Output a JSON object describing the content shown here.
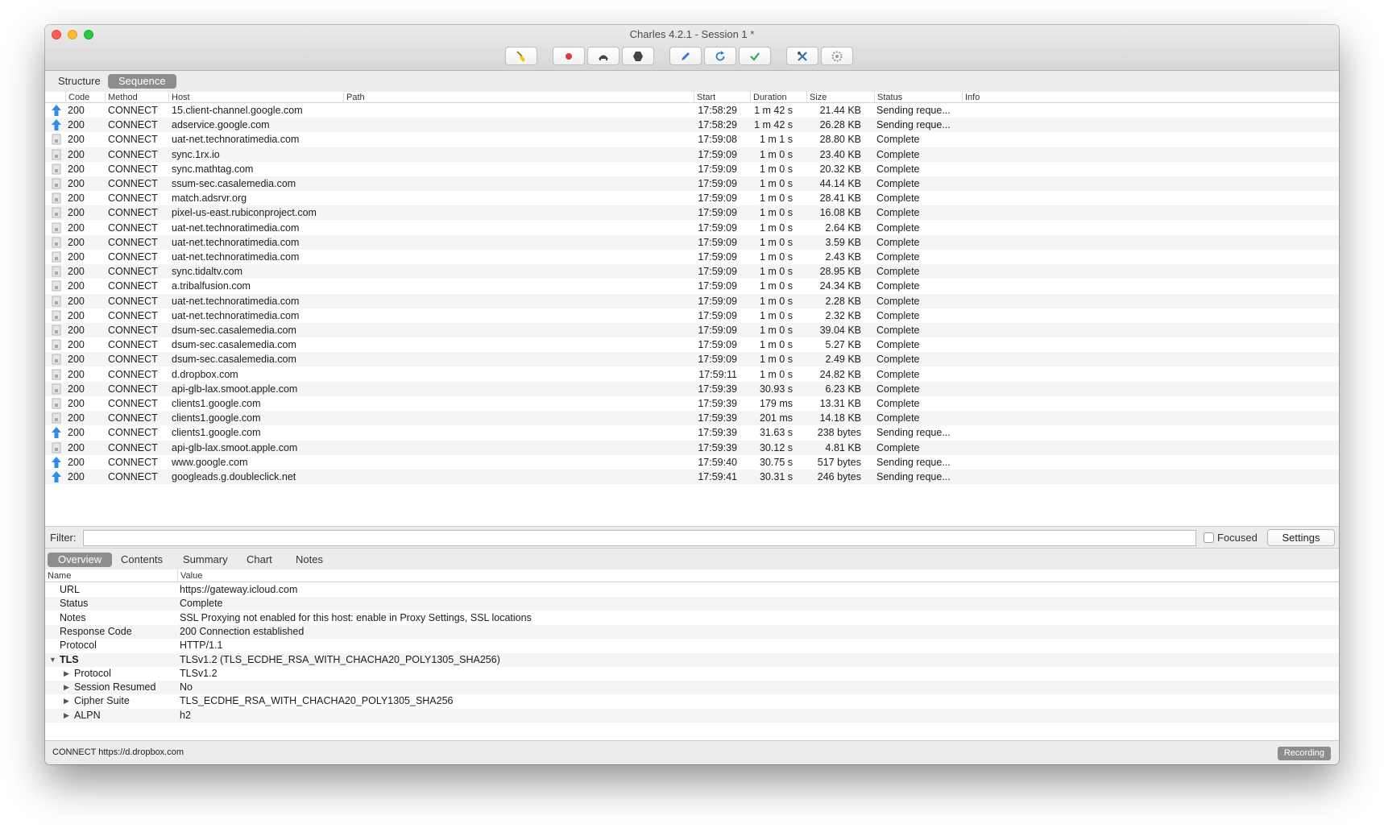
{
  "window": {
    "title": "Charles 4.2.1 - Session 1 *"
  },
  "toolbar": {
    "buttons": [
      {
        "name": "broom-icon",
        "color": "#e6b800"
      },
      {
        "name": "record-icon",
        "color": "#e23b3b"
      },
      {
        "name": "throttle-turtle-icon",
        "color": "#333333"
      },
      {
        "name": "breakpoints-hexagon-icon",
        "color": "#333333"
      },
      {
        "name": "compose-pen-icon",
        "color": "#2a7fd6"
      },
      {
        "name": "repeat-refresh-icon",
        "color": "#2a7fd6"
      },
      {
        "name": "validate-check-icon",
        "color": "#2fa84f"
      },
      {
        "name": "tools-icon",
        "color": "#2a6fb5"
      },
      {
        "name": "settings-gear-icon",
        "color": "#9a9a9a"
      }
    ]
  },
  "view_tabs": [
    {
      "label": "Structure",
      "active": false
    },
    {
      "label": "Sequence",
      "active": true
    }
  ],
  "table": {
    "headers": {
      "code": "Code",
      "method": "Method",
      "host": "Host",
      "path": "Path",
      "start": "Start",
      "duration": "Duration",
      "size": "Size",
      "status": "Status",
      "info": "Info"
    },
    "rows": [
      {
        "icon": "upload-arrow-icon",
        "code": "200",
        "method": "CONNECT",
        "host": "15.client-channel.google.com",
        "path": "",
        "start": "17:58:29",
        "duration": "1 m 42 s",
        "size": "21.44 KB",
        "status": "Sending reque...",
        "info": ""
      },
      {
        "icon": "upload-arrow-icon",
        "code": "200",
        "method": "CONNECT",
        "host": "adservice.google.com",
        "path": "",
        "start": "17:58:29",
        "duration": "1 m 42 s",
        "size": "26.28 KB",
        "status": "Sending reque...",
        "info": ""
      },
      {
        "icon": "lock-icon",
        "code": "200",
        "method": "CONNECT",
        "host": "uat-net.technoratimedia.com",
        "path": "",
        "start": "17:59:08",
        "duration": "1 m 1 s",
        "size": "28.80 KB",
        "status": "Complete",
        "info": ""
      },
      {
        "icon": "lock-icon",
        "code": "200",
        "method": "CONNECT",
        "host": "sync.1rx.io",
        "path": "",
        "start": "17:59:09",
        "duration": "1 m 0 s",
        "size": "23.40 KB",
        "status": "Complete",
        "info": ""
      },
      {
        "icon": "lock-icon",
        "code": "200",
        "method": "CONNECT",
        "host": "sync.mathtag.com",
        "path": "",
        "start": "17:59:09",
        "duration": "1 m 0 s",
        "size": "20.32 KB",
        "status": "Complete",
        "info": ""
      },
      {
        "icon": "lock-icon",
        "code": "200",
        "method": "CONNECT",
        "host": "ssum-sec.casalemedia.com",
        "path": "",
        "start": "17:59:09",
        "duration": "1 m 0 s",
        "size": "44.14 KB",
        "status": "Complete",
        "info": ""
      },
      {
        "icon": "lock-icon",
        "code": "200",
        "method": "CONNECT",
        "host": "match.adsrvr.org",
        "path": "",
        "start": "17:59:09",
        "duration": "1 m 0 s",
        "size": "28.41 KB",
        "status": "Complete",
        "info": ""
      },
      {
        "icon": "lock-icon",
        "code": "200",
        "method": "CONNECT",
        "host": "pixel-us-east.rubiconproject.com",
        "path": "",
        "start": "17:59:09",
        "duration": "1 m 0 s",
        "size": "16.08 KB",
        "status": "Complete",
        "info": ""
      },
      {
        "icon": "lock-icon",
        "code": "200",
        "method": "CONNECT",
        "host": "uat-net.technoratimedia.com",
        "path": "",
        "start": "17:59:09",
        "duration": "1 m 0 s",
        "size": "2.64 KB",
        "status": "Complete",
        "info": ""
      },
      {
        "icon": "lock-icon",
        "code": "200",
        "method": "CONNECT",
        "host": "uat-net.technoratimedia.com",
        "path": "",
        "start": "17:59:09",
        "duration": "1 m 0 s",
        "size": "3.59 KB",
        "status": "Complete",
        "info": ""
      },
      {
        "icon": "lock-icon",
        "code": "200",
        "method": "CONNECT",
        "host": "uat-net.technoratimedia.com",
        "path": "",
        "start": "17:59:09",
        "duration": "1 m 0 s",
        "size": "2.43 KB",
        "status": "Complete",
        "info": ""
      },
      {
        "icon": "lock-icon",
        "code": "200",
        "method": "CONNECT",
        "host": "sync.tidaltv.com",
        "path": "",
        "start": "17:59:09",
        "duration": "1 m 0 s",
        "size": "28.95 KB",
        "status": "Complete",
        "info": ""
      },
      {
        "icon": "lock-icon",
        "code": "200",
        "method": "CONNECT",
        "host": "a.tribalfusion.com",
        "path": "",
        "start": "17:59:09",
        "duration": "1 m 0 s",
        "size": "24.34 KB",
        "status": "Complete",
        "info": ""
      },
      {
        "icon": "lock-icon",
        "code": "200",
        "method": "CONNECT",
        "host": "uat-net.technoratimedia.com",
        "path": "",
        "start": "17:59:09",
        "duration": "1 m 0 s",
        "size": "2.28 KB",
        "status": "Complete",
        "info": ""
      },
      {
        "icon": "lock-icon",
        "code": "200",
        "method": "CONNECT",
        "host": "uat-net.technoratimedia.com",
        "path": "",
        "start": "17:59:09",
        "duration": "1 m 0 s",
        "size": "2.32 KB",
        "status": "Complete",
        "info": ""
      },
      {
        "icon": "lock-icon",
        "code": "200",
        "method": "CONNECT",
        "host": "dsum-sec.casalemedia.com",
        "path": "",
        "start": "17:59:09",
        "duration": "1 m 0 s",
        "size": "39.04 KB",
        "status": "Complete",
        "info": ""
      },
      {
        "icon": "lock-icon",
        "code": "200",
        "method": "CONNECT",
        "host": "dsum-sec.casalemedia.com",
        "path": "",
        "start": "17:59:09",
        "duration": "1 m 0 s",
        "size": "5.27 KB",
        "status": "Complete",
        "info": ""
      },
      {
        "icon": "lock-icon",
        "code": "200",
        "method": "CONNECT",
        "host": "dsum-sec.casalemedia.com",
        "path": "",
        "start": "17:59:09",
        "duration": "1 m 0 s",
        "size": "2.49 KB",
        "status": "Complete",
        "info": ""
      },
      {
        "icon": "lock-icon",
        "code": "200",
        "method": "CONNECT",
        "host": "d.dropbox.com",
        "path": "",
        "start": "17:59:11",
        "duration": "1 m 0 s",
        "size": "24.82 KB",
        "status": "Complete",
        "info": ""
      },
      {
        "icon": "lock-icon",
        "code": "200",
        "method": "CONNECT",
        "host": "api-glb-lax.smoot.apple.com",
        "path": "",
        "start": "17:59:39",
        "duration": "30.93 s",
        "size": "6.23 KB",
        "status": "Complete",
        "info": ""
      },
      {
        "icon": "lock-icon",
        "code": "200",
        "method": "CONNECT",
        "host": "clients1.google.com",
        "path": "",
        "start": "17:59:39",
        "duration": "179 ms",
        "size": "13.31 KB",
        "status": "Complete",
        "info": ""
      },
      {
        "icon": "lock-icon",
        "code": "200",
        "method": "CONNECT",
        "host": "clients1.google.com",
        "path": "",
        "start": "17:59:39",
        "duration": "201 ms",
        "size": "14.18 KB",
        "status": "Complete",
        "info": ""
      },
      {
        "icon": "upload-arrow-icon",
        "code": "200",
        "method": "CONNECT",
        "host": "clients1.google.com",
        "path": "",
        "start": "17:59:39",
        "duration": "31.63 s",
        "size": "238 bytes",
        "status": "Sending reque...",
        "info": ""
      },
      {
        "icon": "lock-icon",
        "code": "200",
        "method": "CONNECT",
        "host": "api-glb-lax.smoot.apple.com",
        "path": "",
        "start": "17:59:39",
        "duration": "30.12 s",
        "size": "4.81 KB",
        "status": "Complete",
        "info": ""
      },
      {
        "icon": "upload-arrow-icon",
        "code": "200",
        "method": "CONNECT",
        "host": "www.google.com",
        "path": "",
        "start": "17:59:40",
        "duration": "30.75 s",
        "size": "517 bytes",
        "status": "Sending reque...",
        "info": ""
      },
      {
        "icon": "upload-arrow-icon",
        "code": "200",
        "method": "CONNECT",
        "host": "googleads.g.doubleclick.net",
        "path": "",
        "start": "17:59:41",
        "duration": "30.31 s",
        "size": "246 bytes",
        "status": "Sending reque...",
        "info": ""
      }
    ]
  },
  "filter": {
    "label": "Filter:",
    "value": "",
    "focused_label": "Focused",
    "focused_checked": false,
    "settings_label": "Settings"
  },
  "detail_tabs": [
    {
      "label": "Overview",
      "active": true
    },
    {
      "label": "Contents",
      "active": false
    },
    {
      "label": "Summary",
      "active": false
    },
    {
      "label": "Chart",
      "active": false
    },
    {
      "label": "Notes",
      "active": false
    }
  ],
  "overview": {
    "headers": {
      "name": "Name",
      "value": "Value"
    },
    "rows": [
      {
        "name": "URL",
        "value": "https://gateway.icloud.com",
        "level": 0,
        "expander": ""
      },
      {
        "name": "Status",
        "value": "Complete",
        "level": 0,
        "expander": ""
      },
      {
        "name": "Notes",
        "value": "SSL Proxying not enabled for this host: enable in Proxy Settings, SSL locations",
        "level": 0,
        "expander": ""
      },
      {
        "name": "Response Code",
        "value": "200 Connection established",
        "level": 0,
        "expander": ""
      },
      {
        "name": "Protocol",
        "value": "HTTP/1.1",
        "level": 0,
        "expander": ""
      },
      {
        "name": "TLS",
        "value": "TLSv1.2 (TLS_ECDHE_RSA_WITH_CHACHA20_POLY1305_SHA256)",
        "level": 0,
        "expander": "expanded",
        "bold": true
      },
      {
        "name": "Protocol",
        "value": "TLSv1.2",
        "level": 1,
        "expander": "collapsed"
      },
      {
        "name": "Session Resumed",
        "value": "No",
        "level": 1,
        "expander": "collapsed"
      },
      {
        "name": "Cipher Suite",
        "value": "TLS_ECDHE_RSA_WITH_CHACHA20_POLY1305_SHA256",
        "level": 1,
        "expander": "collapsed"
      },
      {
        "name": "ALPN",
        "value": "h2",
        "level": 1,
        "expander": "collapsed"
      }
    ]
  },
  "status_bar": {
    "text": "CONNECT https://d.dropbox.com",
    "recording_label": "Recording"
  }
}
